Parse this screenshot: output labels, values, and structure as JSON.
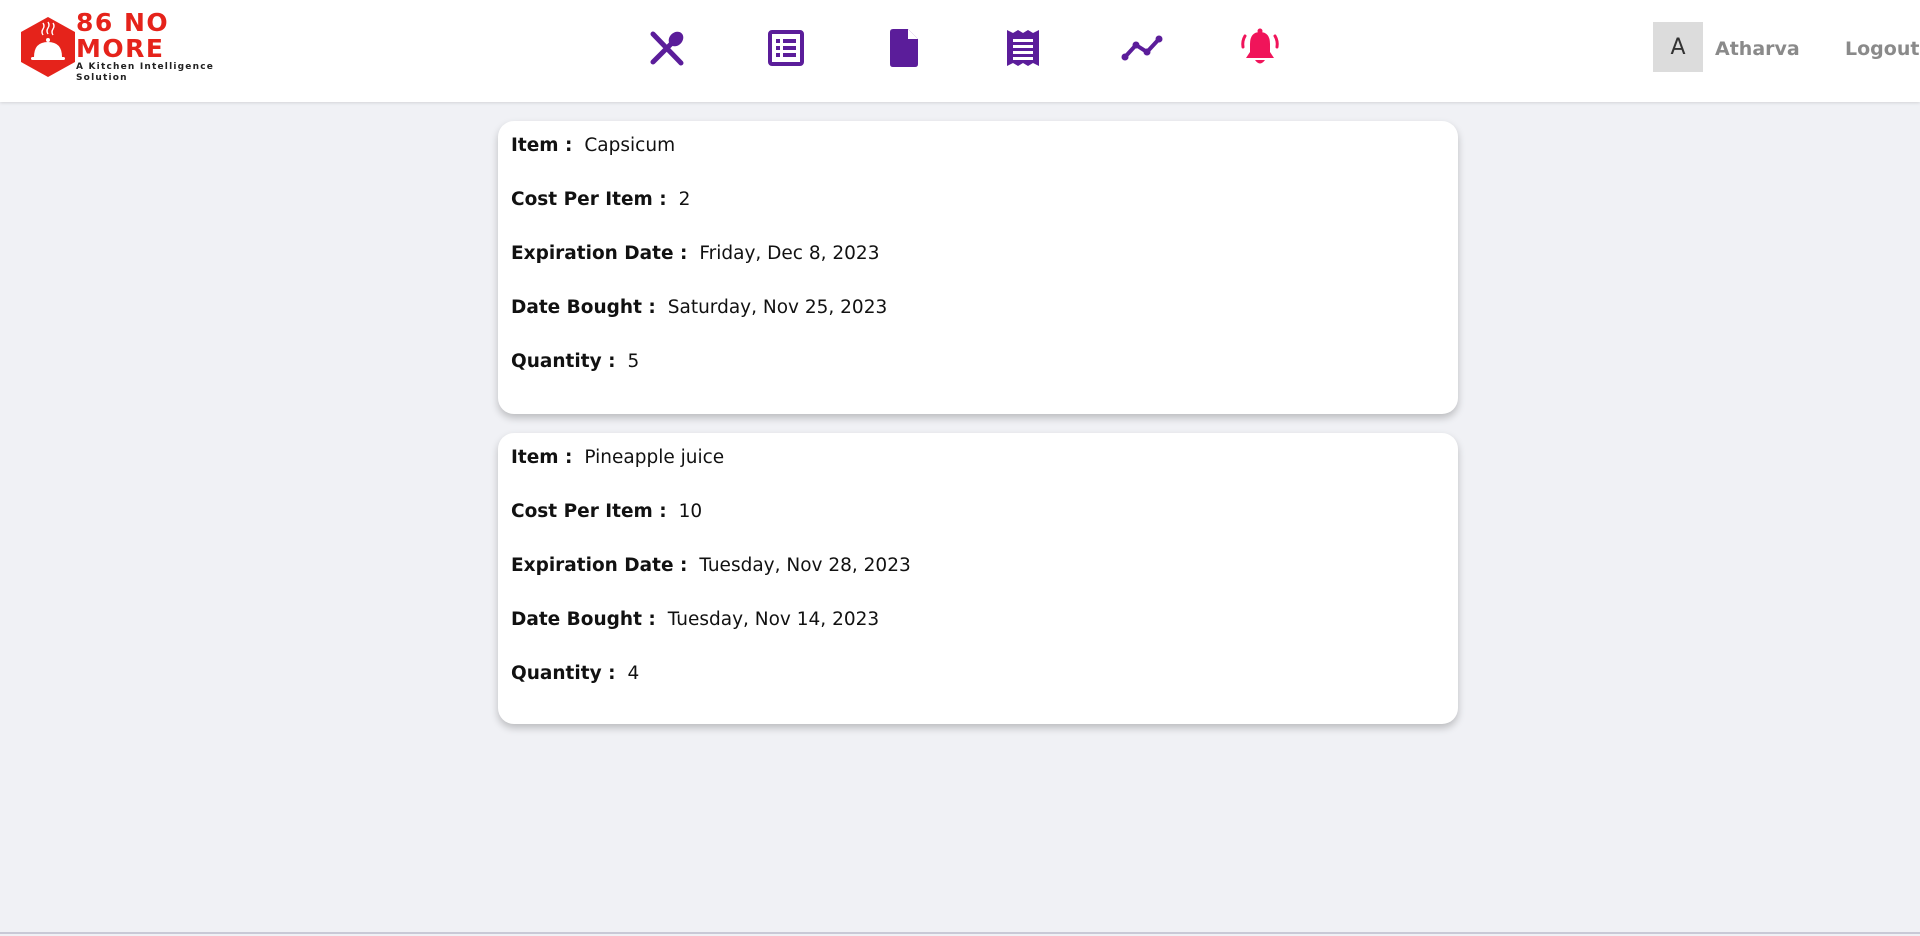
{
  "header": {
    "logo_title": "86 NO MORE",
    "logo_subtitle": "A Kitchen Intelligence Solution",
    "nav": [
      {
        "icon": "utensils-icon",
        "color": "#5b1d9a"
      },
      {
        "icon": "list-icon",
        "color": "#5b1d9a"
      },
      {
        "icon": "file-icon",
        "color": "#5b1d9a"
      },
      {
        "icon": "receipt-icon",
        "color": "#5b1d9a"
      },
      {
        "icon": "chart-line-icon",
        "color": "#5b1d9a"
      },
      {
        "icon": "bell-icon",
        "color": "#f0145a"
      }
    ],
    "user_initial": "A",
    "user_name": "Atharva",
    "logout_label": "Logout"
  },
  "labels": {
    "item": "Item :",
    "cost": "Cost Per Item :",
    "expiration": "Expiration Date :",
    "bought": "Date Bought :",
    "quantity": "Quantity :"
  },
  "items": [
    {
      "item": "Capsicum",
      "cost": "2",
      "expiration": "Friday, Dec 8, 2023",
      "bought": "Saturday, Nov 25, 2023",
      "quantity": "5"
    },
    {
      "item": "Pineapple juice",
      "cost": "10",
      "expiration": "Tuesday, Nov 28, 2023",
      "bought": "Tuesday, Nov 14, 2023",
      "quantity": "4"
    }
  ],
  "colors": {
    "brand_red": "#e5231b",
    "nav_purple": "#5b1d9a",
    "alert_pink": "#f0145a",
    "background": "#f0f1f5"
  }
}
